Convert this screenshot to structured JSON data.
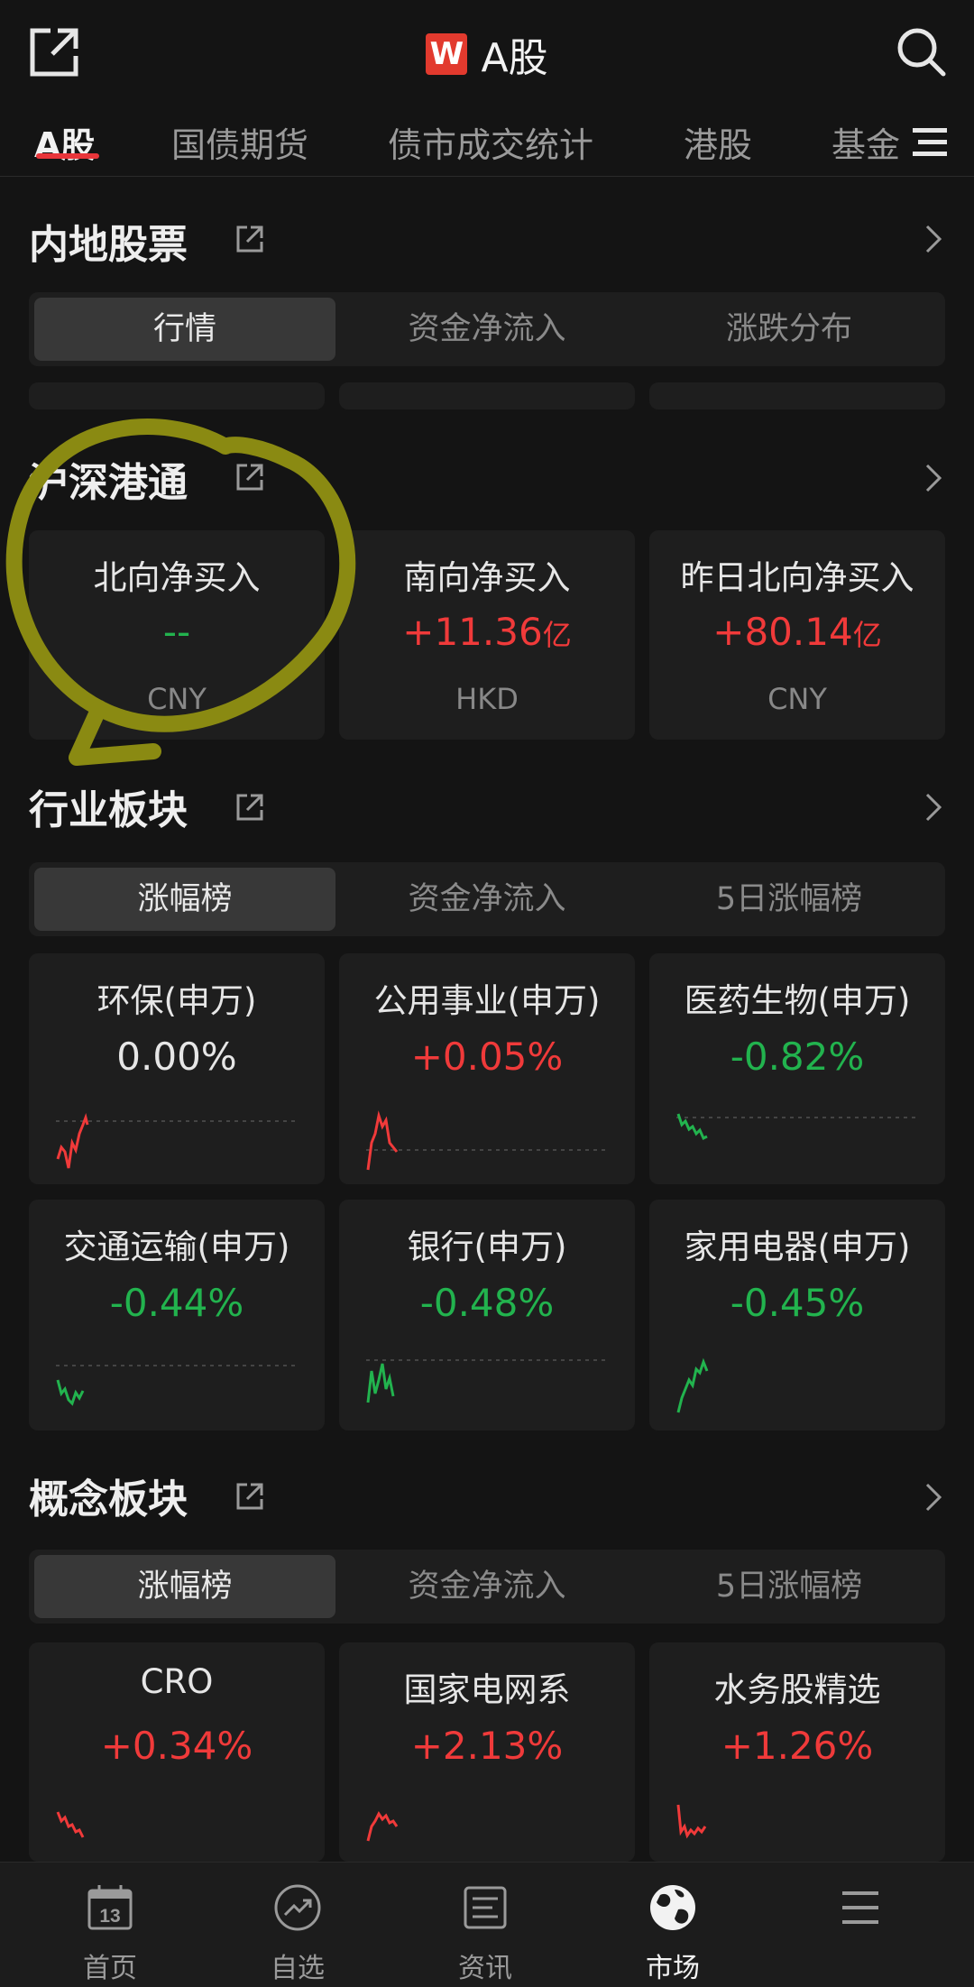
{
  "header": {
    "logo_letter": "W",
    "title": "A股"
  },
  "tabs": [
    {
      "label": "A股"
    },
    {
      "label": "国债期货"
    },
    {
      "label": "债市成交统计"
    },
    {
      "label": "港股"
    },
    {
      "label": "基金"
    }
  ],
  "sections": {
    "mainland": {
      "title": "内地股票",
      "options": [
        "行情",
        "资金净流入",
        "涨跌分布"
      ]
    },
    "connect": {
      "title": "沪深港通",
      "cards": [
        {
          "name": "北向净买入",
          "value": "--",
          "suffix": "",
          "unit": "CNY"
        },
        {
          "name": "南向净买入",
          "value": "+11.36",
          "suffix": "亿",
          "unit": "HKD"
        },
        {
          "name": "昨日北向净买入",
          "value": "+80.14",
          "suffix": "亿",
          "unit": "CNY"
        }
      ]
    },
    "industry": {
      "title": "行业板块",
      "options": [
        "涨幅榜",
        "资金净流入",
        "5日涨幅榜"
      ],
      "cards": [
        {
          "name": "环保(申万)",
          "value": "0.00%"
        },
        {
          "name": "公用事业(申万)",
          "value": "+0.05%"
        },
        {
          "name": "医药生物(申万)",
          "value": "-0.82%"
        },
        {
          "name": "交通运输(申万)",
          "value": "-0.44%"
        },
        {
          "name": "银行(申万)",
          "value": "-0.48%"
        },
        {
          "name": "家用电器(申万)",
          "value": "-0.45%"
        }
      ]
    },
    "concept": {
      "title": "概念板块",
      "options": [
        "涨幅榜",
        "资金净流入",
        "5日涨幅榜"
      ],
      "cards": [
        {
          "name": "CRO",
          "value": "+0.34%"
        },
        {
          "name": "国家电网系",
          "value": "+2.13%"
        },
        {
          "name": "水务股精选",
          "value": "+1.26%"
        }
      ]
    }
  },
  "bottom_nav": [
    {
      "label": "首页",
      "icon": "calendar-icon",
      "day": "13"
    },
    {
      "label": "自选",
      "icon": "trend-circle-icon"
    },
    {
      "label": "资讯",
      "icon": "news-icon"
    },
    {
      "label": "市场",
      "icon": "globe-icon"
    },
    {
      "label": "",
      "icon": "menu-icon"
    }
  ],
  "colors": {
    "up": "#f03a3a",
    "down": "#22b34e",
    "accent": "#e8353a",
    "annotation": "#8a8a12"
  }
}
